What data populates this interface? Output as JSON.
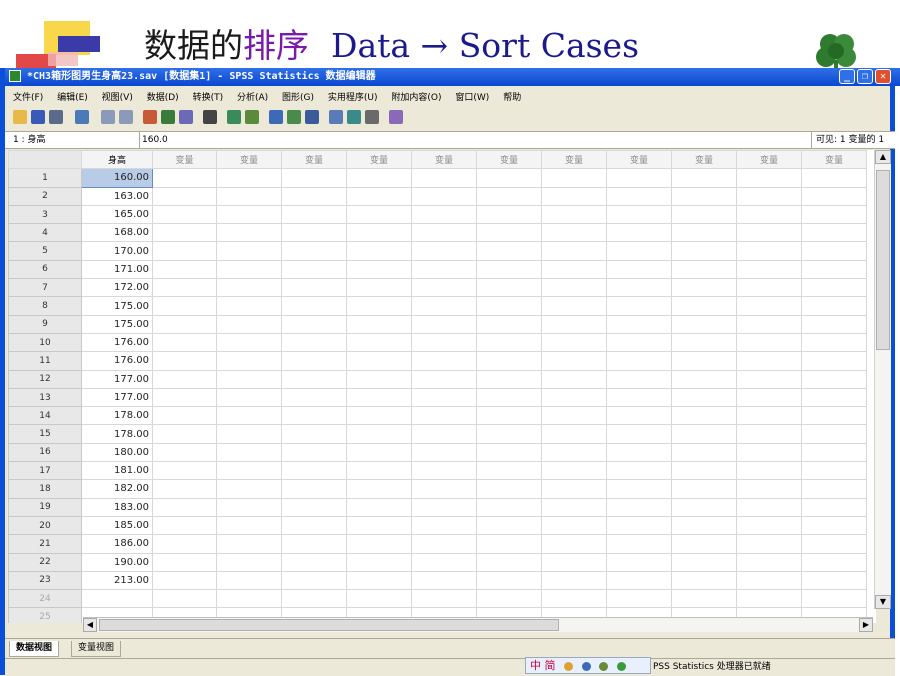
{
  "slide": {
    "title_part1": "数据的",
    "title_part2": "排序",
    "title_part3": "Data → Sort Cases"
  },
  "window": {
    "title": "*CH3箱形图男生身高23.sav [数据集1] - SPSS Statistics 数据编辑器"
  },
  "menu": [
    "文件(F)",
    "编辑(E)",
    "视图(V)",
    "数据(D)",
    "转换(T)",
    "分析(A)",
    "图形(G)",
    "实用程序(U)",
    "附加内容(O)",
    "窗口(W)",
    "帮助"
  ],
  "cellref": {
    "ref": "1 : 身高",
    "value": "160.0",
    "visible": "可见: 1 变量的 1"
  },
  "grid": {
    "active_column": "身高",
    "empty_column": "变量",
    "rows": [
      {
        "n": "1",
        "v": "160.00"
      },
      {
        "n": "2",
        "v": "163.00"
      },
      {
        "n": "3",
        "v": "165.00"
      },
      {
        "n": "4",
        "v": "168.00"
      },
      {
        "n": "5",
        "v": "170.00"
      },
      {
        "n": "6",
        "v": "171.00"
      },
      {
        "n": "7",
        "v": "172.00"
      },
      {
        "n": "8",
        "v": "175.00"
      },
      {
        "n": "9",
        "v": "175.00"
      },
      {
        "n": "10",
        "v": "176.00"
      },
      {
        "n": "11",
        "v": "176.00"
      },
      {
        "n": "12",
        "v": "177.00"
      },
      {
        "n": "13",
        "v": "177.00"
      },
      {
        "n": "14",
        "v": "178.00"
      },
      {
        "n": "15",
        "v": "178.00"
      },
      {
        "n": "16",
        "v": "180.00"
      },
      {
        "n": "17",
        "v": "181.00"
      },
      {
        "n": "18",
        "v": "182.00"
      },
      {
        "n": "19",
        "v": "183.00"
      },
      {
        "n": "20",
        "v": "185.00"
      },
      {
        "n": "21",
        "v": "186.00"
      },
      {
        "n": "22",
        "v": "190.00"
      },
      {
        "n": "23",
        "v": "213.00"
      },
      {
        "n": "24",
        "v": ""
      },
      {
        "n": "25",
        "v": ""
      }
    ]
  },
  "tabs": {
    "data_view": "数据视图",
    "variable_view": "变量视图"
  },
  "ime": {
    "label": "中 简"
  },
  "status": {
    "text": "PSS Statistics  处理器已就绪"
  },
  "colors": {
    "title_bar": "#0a48d0",
    "selected_cell": "#b8cce8"
  }
}
